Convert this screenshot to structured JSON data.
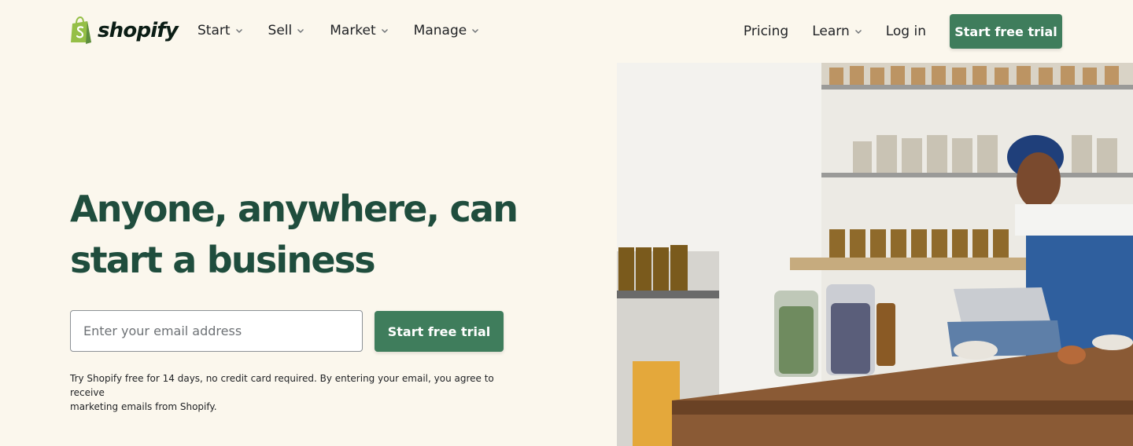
{
  "brand": {
    "name": "shopify"
  },
  "nav": {
    "left": [
      {
        "label": "Start"
      },
      {
        "label": "Sell"
      },
      {
        "label": "Market"
      },
      {
        "label": "Manage"
      }
    ],
    "pricing": "Pricing",
    "learn": "Learn",
    "login": "Log in",
    "cta": "Start free trial"
  },
  "hero": {
    "headline_line1": "Anyone, anywhere, can",
    "headline_line2": "start a business",
    "email_placeholder": "Enter your email address",
    "cta": "Start free trial",
    "disclaimer_line1": "Try Shopify free for 14 days, no credit card required. By entering your email, you agree to receive",
    "disclaimer_line2": "marketing emails from Shopify."
  },
  "colors": {
    "background": "#fbf7ed",
    "accent_green": "#3f7d5c",
    "headline_green": "#1f4d3d",
    "logo_green": "#95bf47"
  }
}
